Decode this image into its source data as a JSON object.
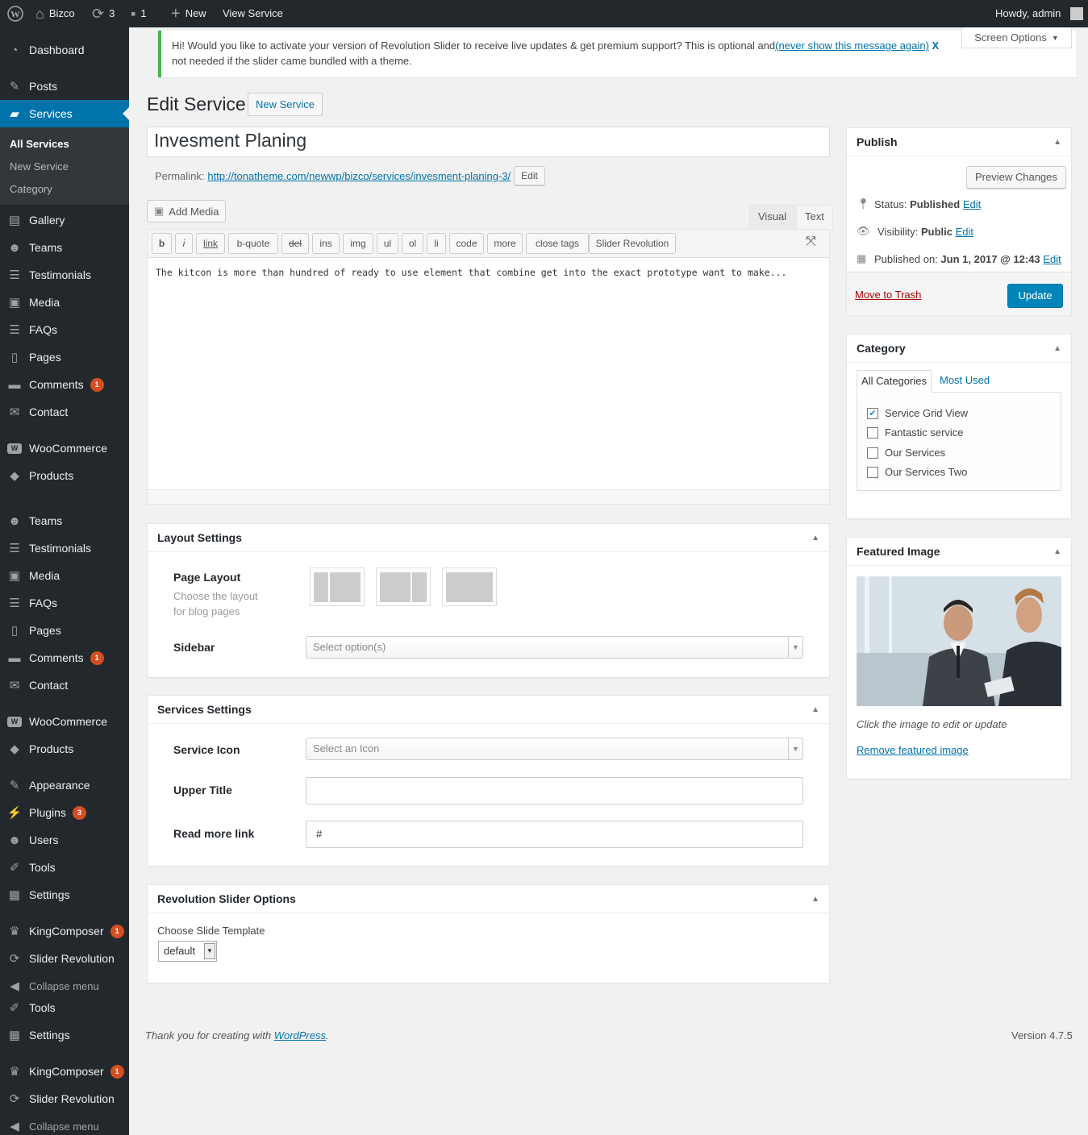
{
  "adminbar": {
    "site_name": "Bizco",
    "updates_count": "3",
    "comments_count": "1",
    "new_label": "New",
    "view_label": "View Service",
    "howdy": "Howdy, admin"
  },
  "sidebar": {
    "items": [
      {
        "label": "Dashboard",
        "icon": "dashboard-icon"
      },
      {
        "label": "Posts",
        "icon": "pin-icon"
      },
      {
        "label": "Services",
        "icon": "briefcase-icon"
      },
      {
        "label": "Gallery",
        "icon": "gallery-icon"
      },
      {
        "label": "Teams",
        "icon": "groups-icon"
      },
      {
        "label": "Testimonials",
        "icon": "testimonial-icon"
      },
      {
        "label": "Media",
        "icon": "media-icon"
      },
      {
        "label": "FAQs",
        "icon": "faq-icon"
      },
      {
        "label": "Pages",
        "icon": "pages-icon"
      },
      {
        "label": "Comments",
        "icon": "comment-icon",
        "badge": "1"
      },
      {
        "label": "Contact",
        "icon": "mail-icon"
      },
      {
        "label": "WooCommerce",
        "icon": "woo-icon"
      },
      {
        "label": "Products",
        "icon": "box-icon"
      },
      {
        "label": "Teams",
        "icon": "groups-icon"
      },
      {
        "label": "Testimonials",
        "icon": "testimonial-icon"
      },
      {
        "label": "Media",
        "icon": "media-icon"
      },
      {
        "label": "FAQs",
        "icon": "faq-icon"
      },
      {
        "label": "Pages",
        "icon": "pages-icon"
      },
      {
        "label": "Comments",
        "icon": "comment-icon",
        "badge": "1"
      },
      {
        "label": "Contact",
        "icon": "mail-icon"
      },
      {
        "label": "WooCommerce",
        "icon": "woo-icon"
      },
      {
        "label": "Products",
        "icon": "box-icon"
      },
      {
        "label": "Appearance",
        "icon": "brush-icon"
      },
      {
        "label": "Plugins",
        "icon": "plugin-icon",
        "badge": "3"
      },
      {
        "label": "Users",
        "icon": "user-icon"
      },
      {
        "label": "Tools",
        "icon": "wrench-icon"
      },
      {
        "label": "Settings",
        "icon": "settings-icon"
      },
      {
        "label": "KingComposer",
        "icon": "crown-icon",
        "badge": "1"
      },
      {
        "label": "Slider Revolution",
        "icon": "refresh-icon"
      },
      {
        "label": "Collapse menu",
        "icon": "collapse-icon"
      },
      {
        "label": "Tools",
        "icon": "wrench-icon"
      },
      {
        "label": "Settings",
        "icon": "settings-icon"
      },
      {
        "label": "KingComposer",
        "icon": "crown-icon",
        "badge": "1"
      },
      {
        "label": "Slider Revolution",
        "icon": "refresh-icon"
      },
      {
        "label": "Collapse menu",
        "icon": "collapse-icon"
      }
    ],
    "submenu": [
      "All Services",
      "New Service",
      "Category"
    ]
  },
  "notice": {
    "text": "Hi! Would you like to activate your version of Revolution Slider to receive live updates & get premium support? This is optional and",
    "link": "(never show this message again)",
    "close": "X",
    "text2": "not needed if the slider came bundled with a theme."
  },
  "screen_options": "Screen Options",
  "page": {
    "title": "Edit Service",
    "new_button": "New Service"
  },
  "post": {
    "title": "Invesment Planing",
    "permalink_label": "Permalink:",
    "permalink_url": "http://tonatheme.com/newwp/bizco/services/invesment-planing-3/",
    "permalink_edit": "Edit"
  },
  "editor": {
    "add_media": "Add Media",
    "tab_visual": "Visual",
    "tab_text": "Text",
    "buttons": [
      "b",
      "i",
      "link",
      "b-quote",
      "del",
      "ins",
      "img",
      "ul",
      "ol",
      "li",
      "code",
      "more",
      "close tags",
      "Slider Revolution"
    ],
    "content": "The kitcon is more than hundred of ready to use element that combine get into the exact prototype want to make..."
  },
  "layout_settings": {
    "title": "Layout Settings",
    "page_layout_label": "Page Layout",
    "page_layout_desc1": "Choose the layout",
    "page_layout_desc2": "for blog pages",
    "sidebar_label": "Sidebar",
    "sidebar_placeholder": "Select option(s)"
  },
  "services_settings": {
    "title": "Services Settings",
    "icon_label": "Service Icon",
    "icon_placeholder": "Select an Icon",
    "upper_title_label": "Upper Title",
    "upper_title_value": "",
    "read_more_label": "Read more link",
    "read_more_value": "#"
  },
  "rev_slider": {
    "title": "Revolution Slider Options",
    "template_label": "Choose Slide Template",
    "template_value": "default"
  },
  "publish": {
    "title": "Publish",
    "preview": "Preview Changes",
    "status_label": "Status:",
    "status_value": "Published",
    "visibility_label": "Visibility:",
    "visibility_value": "Public",
    "published_label": "Published on:",
    "published_value": "Jun 1, 2017 @ 12:43",
    "edit": "Edit",
    "trash": "Move to Trash",
    "update": "Update"
  },
  "category": {
    "title": "Category",
    "tab_all": "All Categories",
    "tab_used": "Most Used",
    "items": [
      {
        "label": "Service Grid View",
        "checked": true
      },
      {
        "label": "Fantastic service",
        "checked": false
      },
      {
        "label": "Our Services",
        "checked": false
      },
      {
        "label": "Our Services Two",
        "checked": false
      }
    ]
  },
  "featured": {
    "title": "Featured Image",
    "hint": "Click the image to edit or update",
    "remove": "Remove featured image"
  },
  "footer": {
    "thanks": "Thank you for creating with",
    "wp_link": "WordPress",
    "version": "Version 4.7.5"
  },
  "colors": {
    "accent": "#0073aa",
    "sidebar": "#23282d",
    "notice_border": "#46b450",
    "badge": "#d54e21"
  }
}
